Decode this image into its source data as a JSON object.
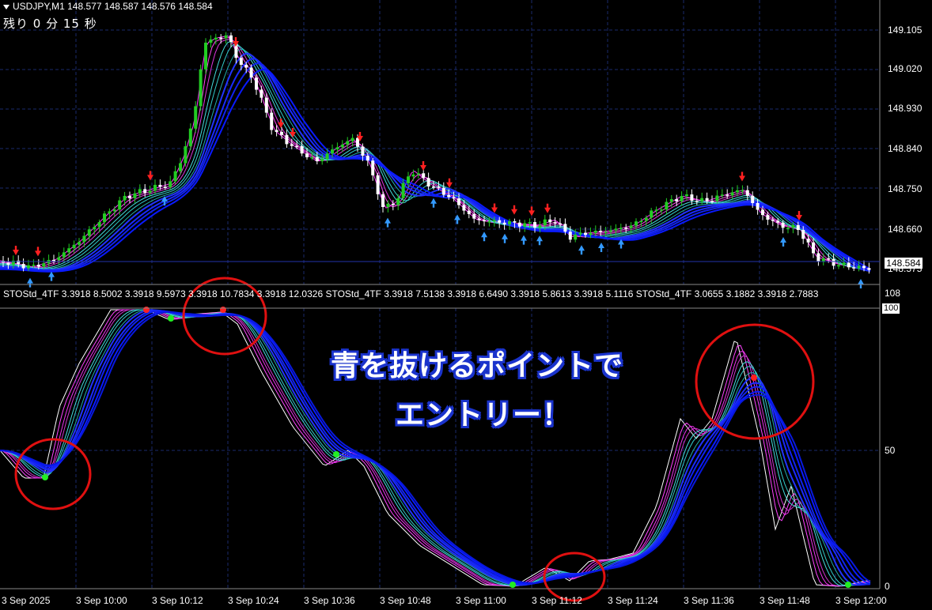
{
  "header": {
    "symbol_info": "USDJPY,M1  148.577 148.587 148.576 148.584",
    "timer": "残り 0 分 15 秒"
  },
  "price_axis": {
    "labels": [
      "149.105",
      "149.020",
      "148.930",
      "148.840",
      "148.750",
      "148.660",
      "148.575"
    ],
    "current_price": "148.584"
  },
  "indicator": {
    "label": "STOStd_4TF 3.3918 8.5002 3.3918 9.5973 3.3918 10.7834 3.3918 12.0326 STOStd_4TF 3.3918 7.5138 3.3918 6.6490 3.3918 5.8613 3.3918 5.1116 STOStd_4TF 3.0655 3.1882 3.3918 2.7883",
    "axis_labels": {
      "top": "108",
      "max": "100",
      "mid": "50",
      "min": "0"
    }
  },
  "time_axis": [
    "3 Sep 2025",
    "3 Sep 10:00",
    "3 Sep 10:12",
    "3 Sep 10:24",
    "3 Sep 10:36",
    "3 Sep 10:48",
    "3 Sep 11:00",
    "3 Sep 11:12",
    "3 Sep 11:24",
    "3 Sep 11:36",
    "3 Sep 11:48",
    "3 Sep 12:00"
  ],
  "callout": {
    "line1": "青を抜けるポイントで",
    "line2": "エントリー！"
  },
  "colors": {
    "background": "#000000",
    "grid": "#1a2a6c",
    "bull_candle": "#22cc22",
    "bear_candle": "#ffffff",
    "sell_arrow": "#ff2020",
    "buy_arrow": "#3399ff",
    "circle": "#e01010",
    "ribbon_fast": "#ff33ff",
    "ribbon_mid": "#33cccc",
    "ribbon_slow": "#1a2aff"
  }
}
